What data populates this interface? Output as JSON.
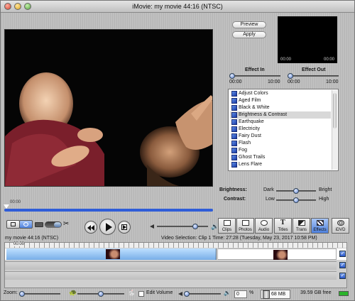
{
  "window": {
    "title": "iMovie: my movie  44:16 (NTSC)"
  },
  "monitor": {
    "time": "00:00"
  },
  "preview": {
    "preview_label": "Preview",
    "apply_label": "Apply",
    "time_start": "00:00",
    "time_end": "00:00"
  },
  "effect_in": {
    "label": "Effect In",
    "min": "00:00",
    "max": "10:00",
    "value": 0.0
  },
  "effect_out": {
    "label": "Effect Out",
    "min": "00:00",
    "max": "10:00",
    "value": 0.0
  },
  "effects": [
    {
      "label": "Adjust Colors"
    },
    {
      "label": "Aged Film"
    },
    {
      "label": "Black & White"
    },
    {
      "label": "Brightness & Contrast"
    },
    {
      "label": "Earthquake"
    },
    {
      "label": "Electricity"
    },
    {
      "label": "Fairy Dust"
    },
    {
      "label": "Flash"
    },
    {
      "label": "Fog"
    },
    {
      "label": "Ghost Trails"
    },
    {
      "label": "Lens Flare"
    }
  ],
  "selected_effect": "Brightness & Contrast",
  "brightness": {
    "label": "Brightness:",
    "min_label": "Dark",
    "max_label": "Bright",
    "value": 0.5
  },
  "contrast": {
    "label": "Contrast:",
    "min_label": "Low",
    "max_label": "High",
    "value": 0.5
  },
  "panes": [
    {
      "label": "Clips",
      "icon": "clips-icon"
    },
    {
      "label": "Photos",
      "icon": "photos-icon"
    },
    {
      "label": "Audio",
      "icon": "audio-icon"
    },
    {
      "label": "Titles",
      "icon": "titles-icon"
    },
    {
      "label": "Trans",
      "icon": "trans-icon"
    },
    {
      "label": "Effects",
      "icon": "effects-icon"
    },
    {
      "label": "iDVD",
      "icon": "idvd-icon"
    }
  ],
  "active_pane": "Effects",
  "info": {
    "movie": "my movie  44:16 (NTSC)",
    "selection": "Video Selection:  Clip 1  Time: 27:28 (Tuesday, May 23, 2017 10:58 PM)"
  },
  "timeline": {
    "ruler_time": "00:00"
  },
  "status": {
    "zoom_label": "Zoom:",
    "edit_volume_label": "Edit Volume",
    "volume_value": "0",
    "volume_unit": "%",
    "trash_size": "68 MB",
    "free_space": "39.59 GB free"
  }
}
